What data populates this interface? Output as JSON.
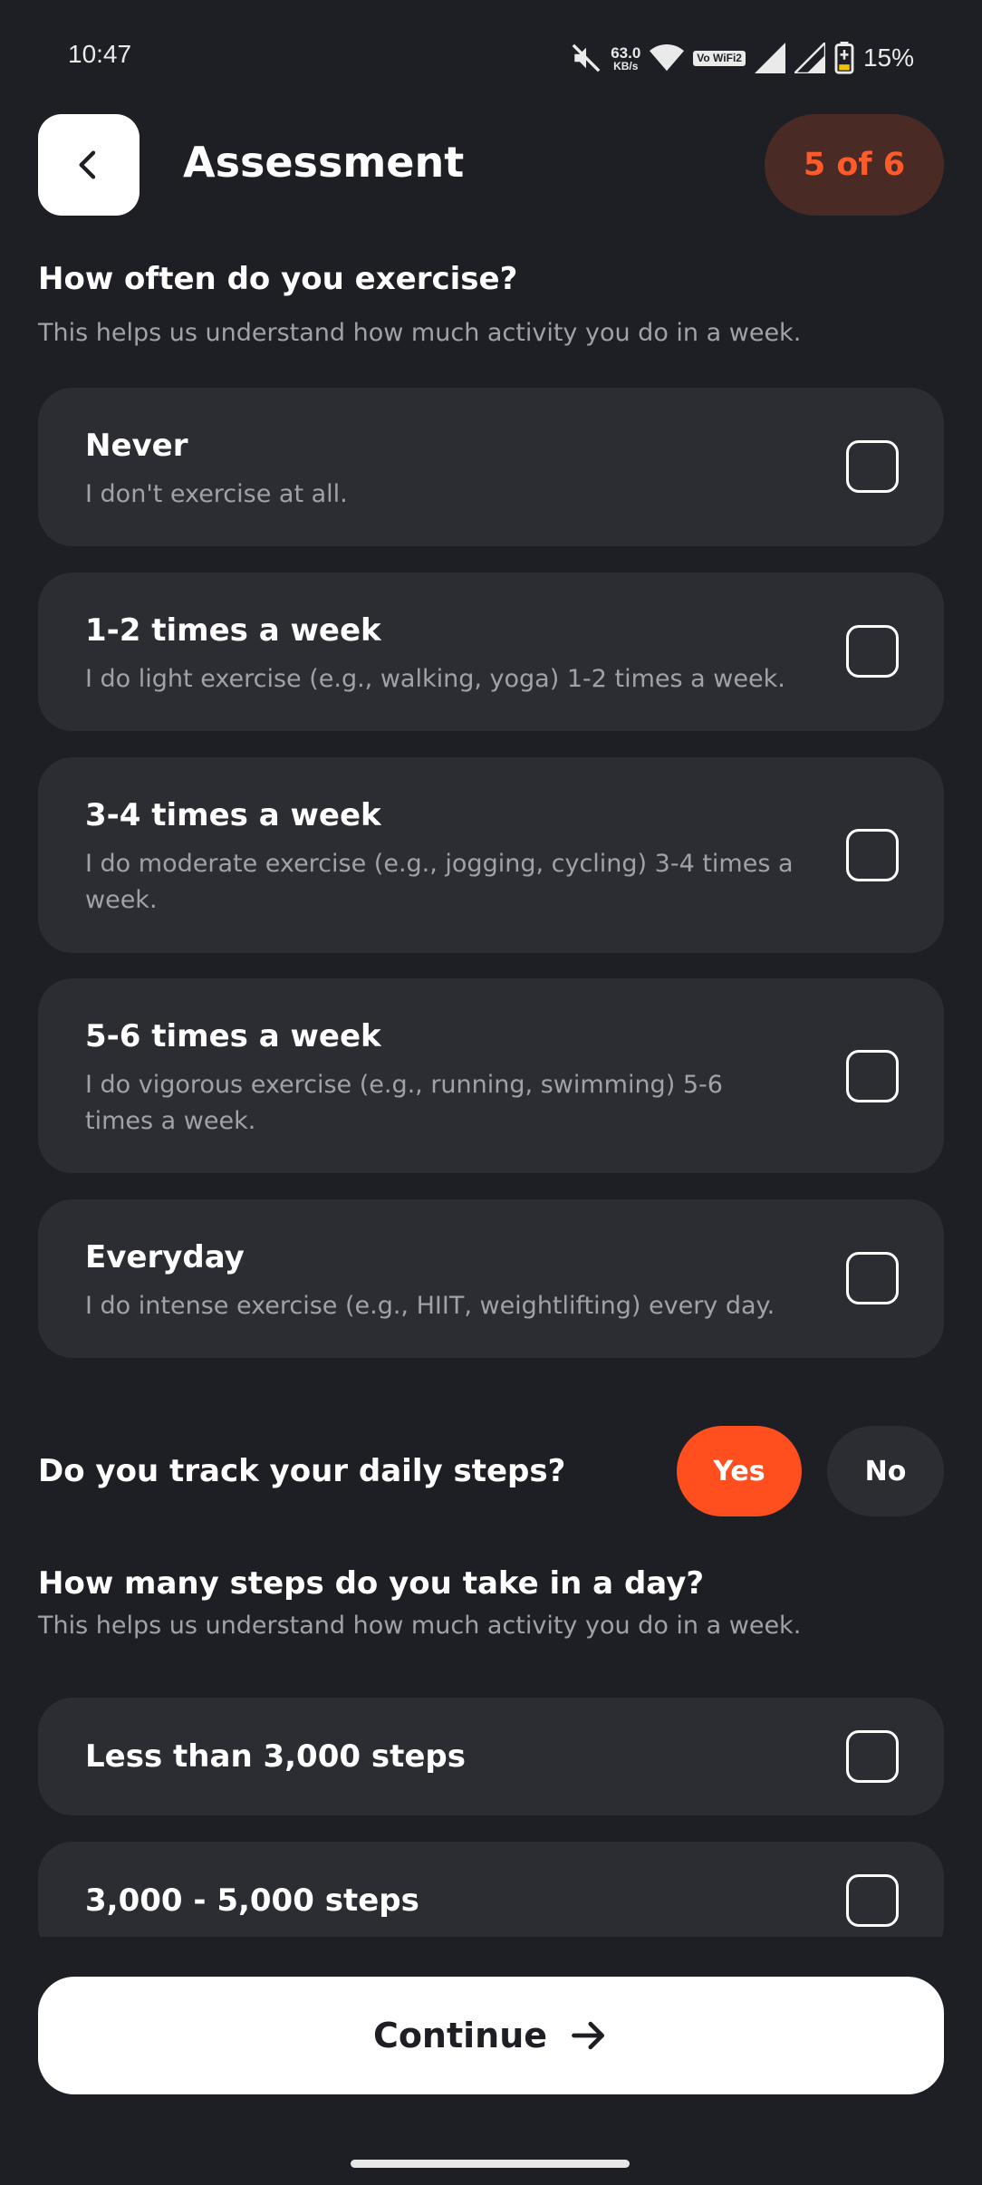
{
  "status_bar": {
    "time": "10:47",
    "net_speed_value": "63.0",
    "net_speed_unit": "KB/s",
    "volte_label": "Vo WiFi2",
    "battery_pct": "15%"
  },
  "header": {
    "title": "Assessment",
    "step": "5 of 6"
  },
  "exercise": {
    "question": "How often do you exercise?",
    "subtitle": "This helps us understand how much activity you do in a week.",
    "options": [
      {
        "title": "Never",
        "desc": "I don't exercise at all."
      },
      {
        "title": "1-2 times a week",
        "desc": "I do light exercise (e.g., walking, yoga) 1-2 times a week."
      },
      {
        "title": "3-4 times a week",
        "desc": "I do moderate exercise (e.g., jogging, cycling) 3-4 times a week."
      },
      {
        "title": "5-6 times a week",
        "desc": "I do vigorous exercise (e.g., running, swimming) 5-6 times a week."
      },
      {
        "title": "Everyday",
        "desc": "I do intense exercise (e.g., HIIT, weightlifting) every day."
      }
    ]
  },
  "track_steps": {
    "question": "Do you track your daily steps?",
    "yes_label": "Yes",
    "no_label": "No",
    "selected": "Yes"
  },
  "steps": {
    "question": "How many steps do you take in a day?",
    "subtitle": "This helps us understand how much activity you do in a week.",
    "options": [
      {
        "title": "Less than 3,000 steps"
      },
      {
        "title": "3,000 - 5,000 steps"
      }
    ]
  },
  "footer": {
    "continue_label": "Continue"
  },
  "colors": {
    "background": "#1e1f24",
    "card": "#2b2d32",
    "accent": "#ff4f1f",
    "step_pill_bg": "#4a2a25"
  }
}
